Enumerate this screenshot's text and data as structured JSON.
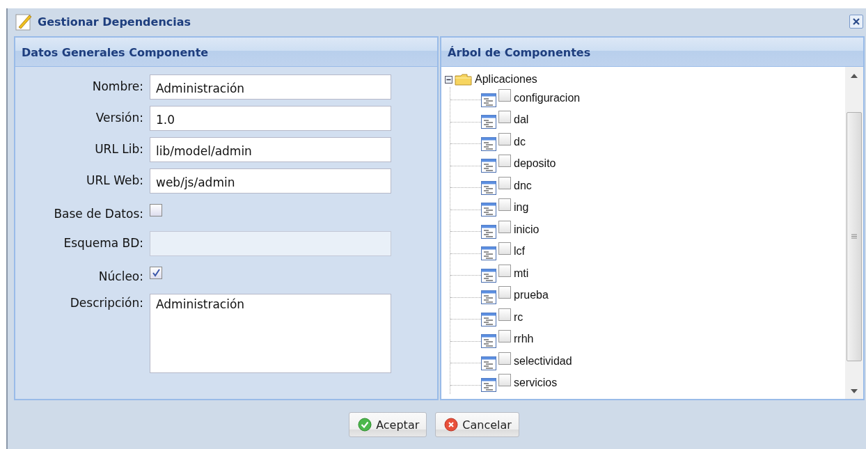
{
  "window": {
    "title": "Gestionar Dependencias"
  },
  "form_panel": {
    "title": "Datos Generales Componente",
    "fields": [
      {
        "kind": "text",
        "label": "Nombre:",
        "value": "Administración",
        "disabled": false
      },
      {
        "kind": "text",
        "label": "Versión:",
        "value": "1.0",
        "disabled": false
      },
      {
        "kind": "text",
        "label": "URL Lib:",
        "value": "lib/model/admin",
        "disabled": false
      },
      {
        "kind": "text",
        "label": "URL Web:",
        "value": "web/js/admin",
        "disabled": false
      },
      {
        "kind": "checkbox",
        "label": "Base de Datos:",
        "checked": false
      },
      {
        "kind": "text",
        "label": "Esquema BD:",
        "disabled": true
      },
      {
        "kind": "checkbox",
        "label": "Núcleo:",
        "checked": true
      },
      {
        "kind": "textarea",
        "label": "Descripción:",
        "value": "Administración",
        "disabled": false
      }
    ]
  },
  "tree_panel": {
    "title": "Árbol de Componentes",
    "tree": [
      {
        "label": "Aplicaciones",
        "expanded": true,
        "children": [
          {
            "label": "configuracion",
            "checked": false
          },
          {
            "label": "dal",
            "checked": false
          },
          {
            "label": "dc",
            "checked": false
          },
          {
            "label": "deposito",
            "checked": false
          },
          {
            "label": "dnc",
            "checked": false
          },
          {
            "label": "ing",
            "checked": false
          },
          {
            "label": "inicio",
            "checked": false
          },
          {
            "label": "lcf",
            "checked": false
          },
          {
            "label": "mti",
            "checked": false
          },
          {
            "label": "prueba",
            "checked": false
          },
          {
            "label": "rc",
            "checked": false
          },
          {
            "label": "rrhh",
            "checked": false
          },
          {
            "label": "selectividad",
            "checked": false
          },
          {
            "label": "servicios",
            "checked": false
          }
        ]
      }
    ]
  },
  "buttons": [
    {
      "kind": "ok",
      "label": "Aceptar"
    },
    {
      "kind": "cancel",
      "label": "Cancelar"
    }
  ]
}
